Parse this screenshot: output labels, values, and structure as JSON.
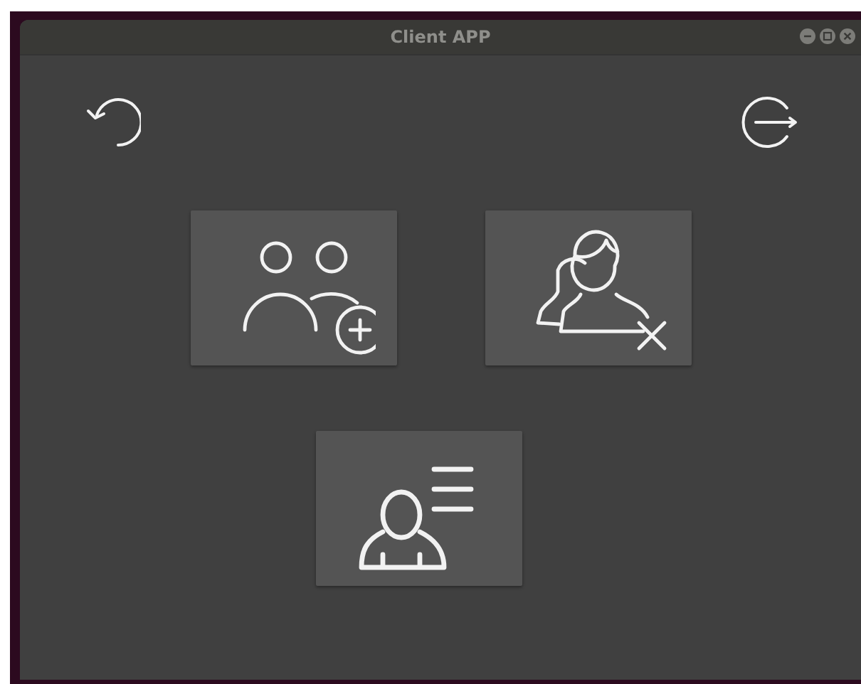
{
  "window": {
    "title": "Client APP"
  }
}
